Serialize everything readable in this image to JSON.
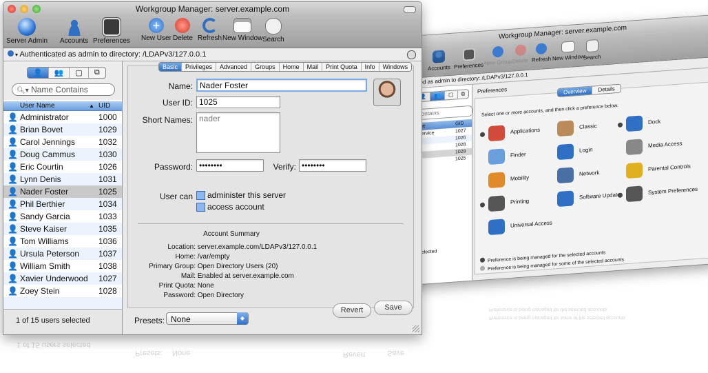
{
  "colors": {
    "accent": "#2f6fc4",
    "selection": "#c9c9c9",
    "window_bg": "#e8e8e8"
  },
  "back_window": {
    "title": "Workgroup Manager: server.example.com",
    "toolbar": {
      "accounts": "Accounts",
      "preferences": "Preferences",
      "new_group": "New Group",
      "delete": "Delete",
      "refresh": "Refresh",
      "new_window": "New Window",
      "search": "Search"
    },
    "path": "ated as admin to directory: /LDAPv3/127.0.0.1",
    "search_placeholder": "Contains",
    "columns": {
      "name": "Name",
      "gid": "GID"
    },
    "groups": [
      {
        "name": "er Service",
        "gid": "1027"
      },
      {
        "name": "ng",
        "gid": "1026"
      },
      {
        "name": "ons",
        "gid": "1028"
      },
      {
        "name": "",
        "gid": "1029"
      },
      {
        "name": "oup",
        "gid": "1025"
      }
    ],
    "status": "ps selected",
    "section_title": "Preferences",
    "tabs": {
      "overview": "Overview",
      "details": "Details"
    },
    "instruction": "Select one or more accounts, and then click a preference below.",
    "prefs": [
      {
        "label": "Applications",
        "icon": "applications-icon",
        "managed": true
      },
      {
        "label": "Classic",
        "icon": "classic-icon",
        "managed": false
      },
      {
        "label": "Dock",
        "icon": "dock-icon",
        "managed": true
      },
      {
        "label": "Finder",
        "icon": "finder-icon",
        "managed": false
      },
      {
        "label": "Login",
        "icon": "login-icon",
        "managed": false
      },
      {
        "label": "Media Access",
        "icon": "media-access-icon",
        "managed": false
      },
      {
        "label": "Mobility",
        "icon": "mobility-icon",
        "managed": false
      },
      {
        "label": "Network",
        "icon": "network-icon",
        "managed": false
      },
      {
        "label": "Parental Controls",
        "icon": "parental-controls-icon",
        "managed": false
      },
      {
        "label": "Printing",
        "icon": "printing-icon",
        "managed": true
      },
      {
        "label": "Software Update",
        "icon": "software-update-icon",
        "managed": false
      },
      {
        "label": "System Preferences",
        "icon": "system-preferences-icon",
        "managed": true
      },
      {
        "label": "Universal Access",
        "icon": "universal-access-icon",
        "managed": false
      }
    ],
    "legend_all": "Preference is being managed for the selected accounts",
    "legend_some": "Preference is being managed for some of the selected accounts"
  },
  "front_window": {
    "title": "Workgroup Manager: server.example.com",
    "toolbar": {
      "server_admin": "Server Admin",
      "accounts": "Accounts",
      "preferences": "Preferences",
      "new_user": "New User",
      "delete": "Delete",
      "refresh": "Refresh",
      "new_window": "New Window",
      "search": "Search"
    },
    "path": "Authenticated as admin to directory: /LDAPv3/127.0.0.1",
    "search_placeholder": "Name Contains",
    "columns": {
      "name": "User Name",
      "uid": "UID"
    },
    "users": [
      {
        "name": "Administrator",
        "uid": "1000"
      },
      {
        "name": "Brian Bovet",
        "uid": "1029"
      },
      {
        "name": "Carol Jennings",
        "uid": "1032"
      },
      {
        "name": "Doug Cammus",
        "uid": "1030"
      },
      {
        "name": "Eric Courtin",
        "uid": "1026"
      },
      {
        "name": "Lynn Denis",
        "uid": "1031"
      },
      {
        "name": "Nader Foster",
        "uid": "1025"
      },
      {
        "name": "Phil Berthier",
        "uid": "1034"
      },
      {
        "name": "Sandy Garcia",
        "uid": "1033"
      },
      {
        "name": "Steve Kaiser",
        "uid": "1035"
      },
      {
        "name": "Tom Williams",
        "uid": "1036"
      },
      {
        "name": "Ursula Peterson",
        "uid": "1037"
      },
      {
        "name": "William Smith",
        "uid": "1038"
      },
      {
        "name": "Xavier Underwood",
        "uid": "1027"
      },
      {
        "name": "Zoey Stein",
        "uid": "1028"
      }
    ],
    "status": "1 of 15 users selected",
    "tabs": [
      "Basic",
      "Privileges",
      "Advanced",
      "Groups",
      "Home",
      "Mail",
      "Print Quota",
      "Info",
      "Windows"
    ],
    "form": {
      "name_label": "Name:",
      "name_value": "Nader Foster",
      "userid_label": "User ID:",
      "userid_value": "1025",
      "short_names_label": "Short Names:",
      "short_name_value": "nader",
      "password_label": "Password:",
      "password_value": "••••••••",
      "verify_label": "Verify:",
      "verify_value": "••••••••",
      "user_can_label": "User can",
      "administer_label": "administer this server",
      "access_label": "access account"
    },
    "summary": {
      "title": "Account Summary",
      "location_label": "Location:",
      "location_value": "server.example.com/LDAPv3/127.0.0.1",
      "home_label": "Home:",
      "home_value": "/var/empty",
      "group_label": "Primary Group:",
      "group_value": "Open Directory Users (20)",
      "mail_label": "Mail:",
      "mail_value": "Enabled at server.example.com",
      "quota_label": "Print Quota:",
      "quota_value": "None",
      "password_label": "Password:",
      "password_value": "Open Directory"
    },
    "presets_label": "Presets:",
    "presets_value": "None",
    "revert": "Revert",
    "save": "Save"
  }
}
